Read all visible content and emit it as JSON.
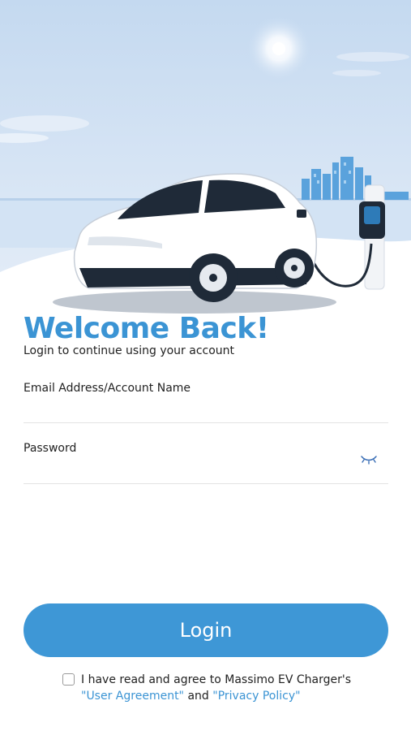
{
  "hero": {
    "image": "ev-charging-illustration"
  },
  "welcome": {
    "title": "Welcome Back!",
    "subtitle": "Login to continue using your account"
  },
  "form": {
    "email_label": "Email Address/Account Name",
    "email_value": "",
    "password_label": "Password",
    "password_value": "",
    "password_toggle_icon": "eye-closed-icon"
  },
  "login": {
    "label": "Login"
  },
  "agreement": {
    "checked": false,
    "text_prefix": "I have read and agree to Massimo EV Charger's",
    "user_agreement": "\"User Agreement\"",
    "and": "and",
    "privacy_policy": "\"Privacy Policy\""
  },
  "colors": {
    "accent": "#3b94d4",
    "button": "#3e97d6",
    "sky": "#cfe0f3"
  }
}
